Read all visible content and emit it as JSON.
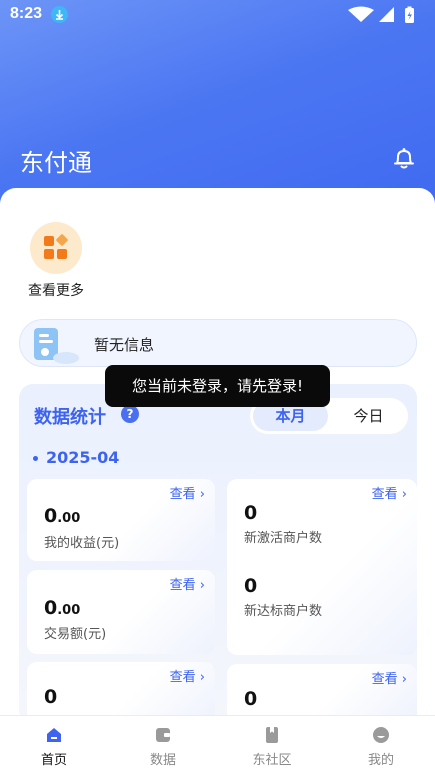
{
  "status_bar": {
    "time": "8:23"
  },
  "header": {
    "title": "东付通"
  },
  "shortcut": {
    "label": "查看更多"
  },
  "notice": {
    "text": "暂无信息"
  },
  "toast": {
    "text": "您当前未登录，请先登录!"
  },
  "stats": {
    "title": "数据统计",
    "help": "?",
    "tabs": {
      "active": "本月",
      "other": "今日"
    },
    "period": "2025-04",
    "link_label": "查看 ›",
    "cards": [
      {
        "value_int": "0",
        "value_dec": ".00",
        "caption": "我的收益(元)"
      },
      {
        "value_int": "0",
        "value_dec": "",
        "caption": "新激活商户数"
      },
      {
        "value_int": "0",
        "value_dec": ".00",
        "caption": "交易额(元)"
      },
      {
        "value_int": "0",
        "value_dec": "",
        "caption": "新达标商户数"
      },
      {
        "value_int": "0",
        "value_dec": "",
        "caption": ""
      },
      {
        "value_int": "0",
        "value_dec": "",
        "caption": ""
      }
    ]
  },
  "tabbar": {
    "items": [
      {
        "label": "首页",
        "icon": "home-icon"
      },
      {
        "label": "数据",
        "icon": "data-icon"
      },
      {
        "label": "东社区",
        "icon": "community-icon"
      },
      {
        "label": "我的",
        "icon": "profile-icon"
      }
    ],
    "active_index": 0
  },
  "colors": {
    "brand": "#3d63ef",
    "hero": "#4b76f2",
    "shortcut_bg": "#fde9cb"
  }
}
